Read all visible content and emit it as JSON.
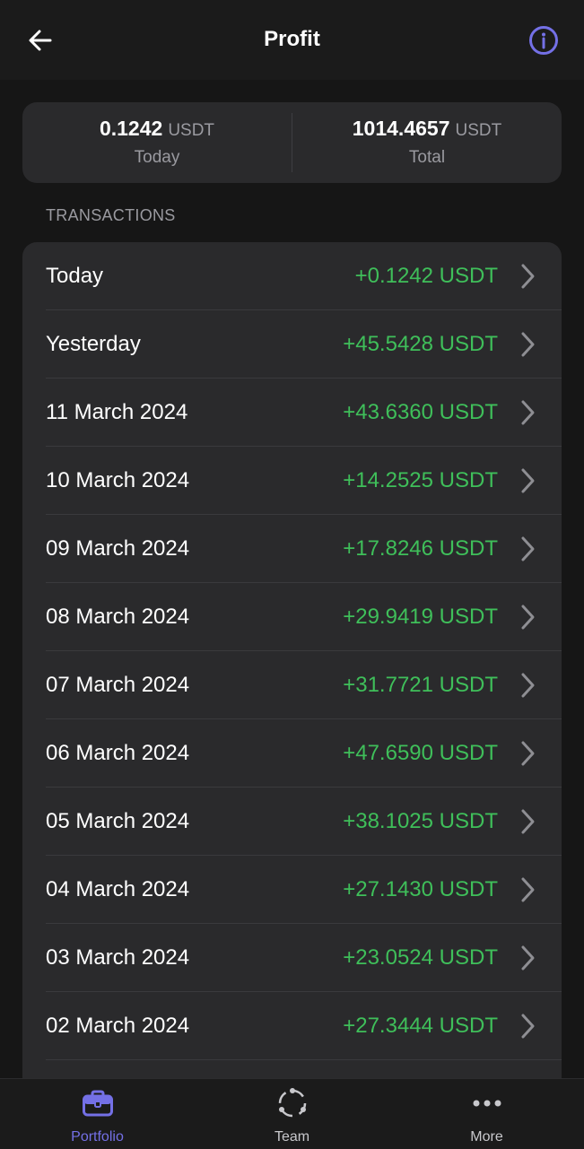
{
  "header": {
    "title": "Profit"
  },
  "summary": {
    "today": {
      "amount": "0.1242",
      "unit": "USDT",
      "caption": "Today"
    },
    "total": {
      "amount": "1014.4657",
      "unit": "USDT",
      "caption": "Total"
    }
  },
  "transactions": {
    "section_label": "TRANSACTIONS",
    "rows": [
      {
        "label": "Today",
        "amount": "+0.1242 USDT"
      },
      {
        "label": "Yesterday",
        "amount": "+45.5428 USDT"
      },
      {
        "label": "11 March 2024",
        "amount": "+43.6360 USDT"
      },
      {
        "label": "10 March 2024",
        "amount": "+14.2525 USDT"
      },
      {
        "label": "09 March 2024",
        "amount": "+17.8246 USDT"
      },
      {
        "label": "08 March 2024",
        "amount": "+29.9419 USDT"
      },
      {
        "label": "07 March 2024",
        "amount": "+31.7721 USDT"
      },
      {
        "label": "06 March 2024",
        "amount": "+47.6590 USDT"
      },
      {
        "label": "05 March 2024",
        "amount": "+38.1025 USDT"
      },
      {
        "label": "04 March 2024",
        "amount": "+27.1430 USDT"
      },
      {
        "label": "03 March 2024",
        "amount": "+23.0524 USDT"
      },
      {
        "label": "02 March 2024",
        "amount": "+27.3444 USDT"
      }
    ]
  },
  "tabbar": {
    "items": [
      {
        "label": "Portfolio",
        "icon": "briefcase-icon",
        "active": true
      },
      {
        "label": "Team",
        "icon": "team-circle-icon",
        "active": false
      },
      {
        "label": "More",
        "icon": "more-dots-icon",
        "active": false
      }
    ]
  },
  "colors": {
    "accent": "#7470e6",
    "positive": "#3fbf5a",
    "background": "#161616",
    "card": "#2a2a2c"
  }
}
